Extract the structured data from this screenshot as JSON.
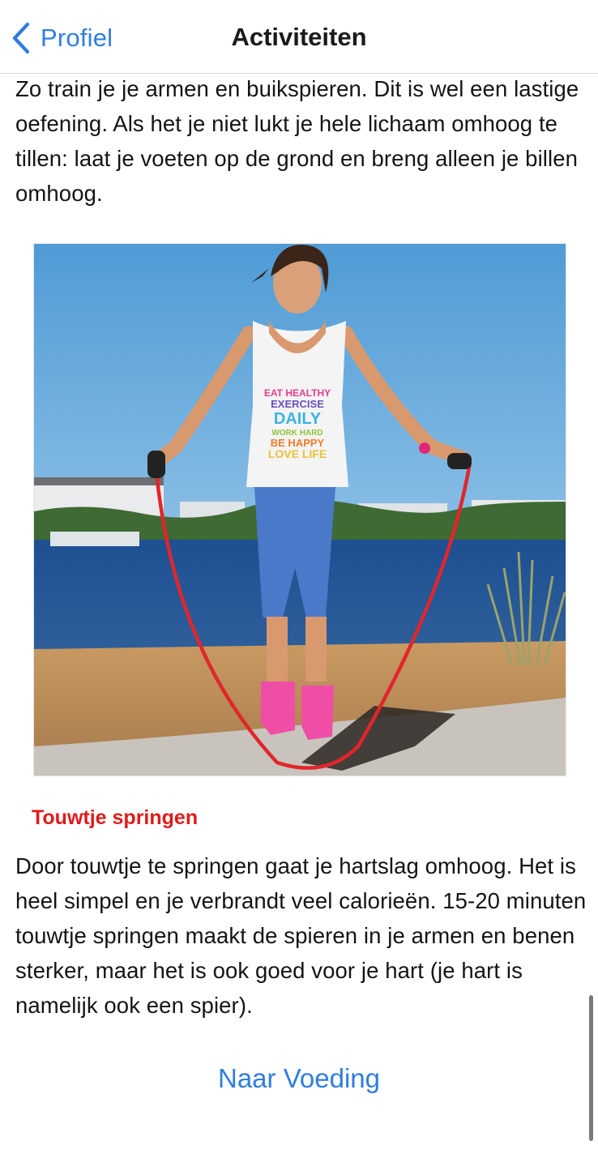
{
  "navbar": {
    "back_label": "Profiel",
    "title": "Activiteiten",
    "back_icon": "chevron-left-icon"
  },
  "content": {
    "intro_text": "Zo train je je armen en buikspieren. Dit is wel een lastige oefening. Als het je niet lukt je hele lichaam omhoog te tillen: laat je voeten op de grond en breng alleen je billen omhoog.",
    "section_title": "Touwtje springen",
    "section_text": "Door touwtje te springen gaat je hartslag omhoog. Het is heel simpel en je verbrandt veel calorieën. 15-20 minuten touwtje springen maakt de spieren in je armen en benen sterker, maar het is ook goed voor je hart (je hart is namelijk ook een spier).",
    "next_button": "Naar Voeding",
    "shirt_lines": [
      "EAT HEALTHY",
      "EXERCISE",
      "DAILY",
      "WORK HARD",
      "BE HAPPY",
      "LOVE LIFE"
    ]
  },
  "colors": {
    "accent": "#2f7de1",
    "section_title": "#e21a1a",
    "text": "#141414"
  }
}
